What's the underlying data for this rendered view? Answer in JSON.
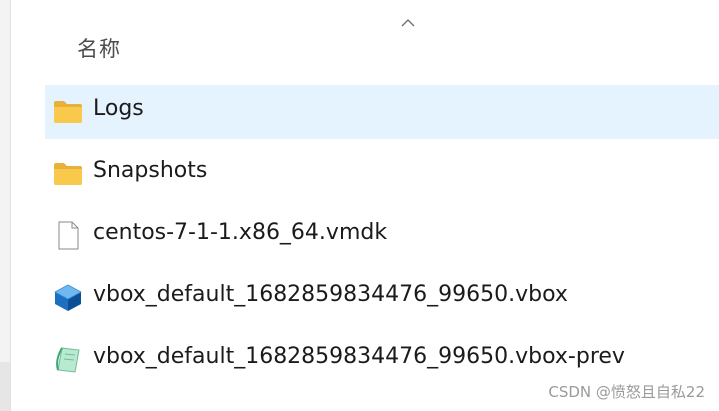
{
  "header": {
    "name_column": "名称"
  },
  "files": [
    {
      "name": "Logs",
      "icon": "folder-icon",
      "selected": true
    },
    {
      "name": "Snapshots",
      "icon": "folder-icon",
      "selected": false
    },
    {
      "name": "centos-7-1-1.x86_64.vmdk",
      "icon": "file-icon",
      "selected": false
    },
    {
      "name": "vbox_default_1682859834476_99650.vbox",
      "icon": "virtualbox-icon",
      "selected": false
    },
    {
      "name": "vbox_default_1682859834476_99650.vbox-prev",
      "icon": "vbox-prev-icon",
      "selected": false
    }
  ],
  "watermark": "CSDN @愤怒且自私22",
  "colors": {
    "selection": "#e5f3ff",
    "folder": "#f8c94a"
  }
}
